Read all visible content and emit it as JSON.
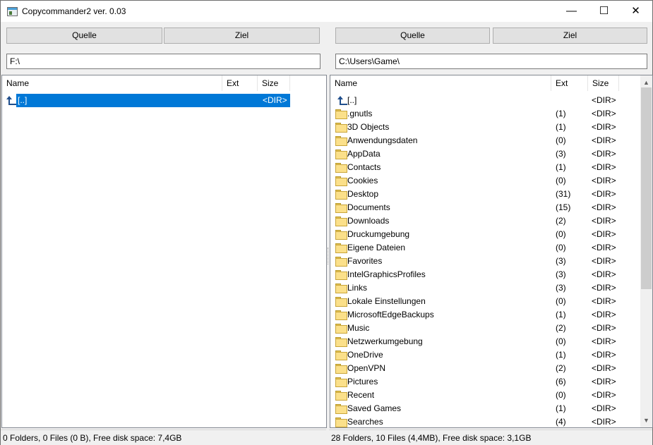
{
  "window": {
    "title": "Copycommander2 ver. 0.03",
    "min_glyph": "—",
    "max_glyph": "☐",
    "close_glyph": "✕"
  },
  "left": {
    "source_label": "Quelle",
    "target_label": "Ziel",
    "path": "F:\\",
    "columns": {
      "name": "Name",
      "ext": "Ext",
      "size": "Size"
    },
    "rows": [
      {
        "name": "[..]",
        "ext": "",
        "size": "<DIR>",
        "icon": "parent-dir-icon",
        "selected": true
      }
    ],
    "status": "0 Folders, 0 Files (0 B), Free disk space: 7,4GB"
  },
  "right": {
    "source_label": "Quelle",
    "target_label": "Ziel",
    "path": "C:\\Users\\Game\\",
    "columns": {
      "name": "Name",
      "ext": "Ext",
      "size": "Size"
    },
    "rows": [
      {
        "name": "[..]",
        "ext": "",
        "size": "<DIR>",
        "icon": "parent-dir-icon"
      },
      {
        "name": ".gnutls",
        "ext": "(1)",
        "size": "<DIR>",
        "icon": "folder-icon"
      },
      {
        "name": "3D Objects",
        "ext": "(1)",
        "size": "<DIR>",
        "icon": "folder-icon"
      },
      {
        "name": "Anwendungsdaten",
        "ext": "(0)",
        "size": "<DIR>",
        "icon": "folder-icon"
      },
      {
        "name": "AppData",
        "ext": "(3)",
        "size": "<DIR>",
        "icon": "folder-icon"
      },
      {
        "name": "Contacts",
        "ext": "(1)",
        "size": "<DIR>",
        "icon": "folder-icon"
      },
      {
        "name": "Cookies",
        "ext": "(0)",
        "size": "<DIR>",
        "icon": "folder-icon"
      },
      {
        "name": "Desktop",
        "ext": "(31)",
        "size": "<DIR>",
        "icon": "folder-icon"
      },
      {
        "name": "Documents",
        "ext": "(15)",
        "size": "<DIR>",
        "icon": "folder-icon"
      },
      {
        "name": "Downloads",
        "ext": "(2)",
        "size": "<DIR>",
        "icon": "folder-icon"
      },
      {
        "name": "Druckumgebung",
        "ext": "(0)",
        "size": "<DIR>",
        "icon": "folder-icon"
      },
      {
        "name": "Eigene Dateien",
        "ext": "(0)",
        "size": "<DIR>",
        "icon": "folder-icon"
      },
      {
        "name": "Favorites",
        "ext": "(3)",
        "size": "<DIR>",
        "icon": "folder-icon"
      },
      {
        "name": "IntelGraphicsProfiles",
        "ext": "(3)",
        "size": "<DIR>",
        "icon": "folder-icon"
      },
      {
        "name": "Links",
        "ext": "(3)",
        "size": "<DIR>",
        "icon": "folder-icon"
      },
      {
        "name": "Lokale Einstellungen",
        "ext": "(0)",
        "size": "<DIR>",
        "icon": "folder-icon"
      },
      {
        "name": "MicrosoftEdgeBackups",
        "ext": "(1)",
        "size": "<DIR>",
        "icon": "folder-icon"
      },
      {
        "name": "Music",
        "ext": "(2)",
        "size": "<DIR>",
        "icon": "folder-icon"
      },
      {
        "name": "Netzwerkumgebung",
        "ext": "(0)",
        "size": "<DIR>",
        "icon": "folder-icon"
      },
      {
        "name": "OneDrive",
        "ext": "(1)",
        "size": "<DIR>",
        "icon": "folder-icon"
      },
      {
        "name": "OpenVPN",
        "ext": "(2)",
        "size": "<DIR>",
        "icon": "folder-icon"
      },
      {
        "name": "Pictures",
        "ext": "(6)",
        "size": "<DIR>",
        "icon": "folder-icon"
      },
      {
        "name": "Recent",
        "ext": "(0)",
        "size": "<DIR>",
        "icon": "folder-icon"
      },
      {
        "name": "Saved Games",
        "ext": "(1)",
        "size": "<DIR>",
        "icon": "folder-icon"
      },
      {
        "name": "Searches",
        "ext": "(4)",
        "size": "<DIR>",
        "icon": "folder-icon"
      }
    ],
    "status": "28 Folders, 10 Files (4,4MB), Free disk space: 3,1GB"
  }
}
